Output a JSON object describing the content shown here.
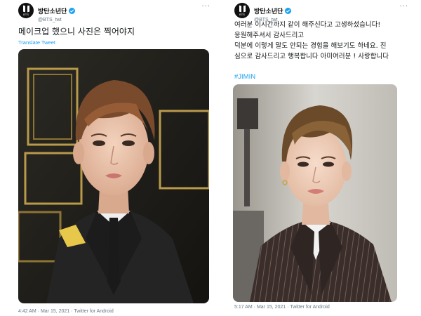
{
  "tweets": [
    {
      "account": {
        "display_name": "방탄소년단",
        "handle": "@BTS_twt",
        "logo_text": "BTS"
      },
      "text": "메이크업 했으니 사진은 찍어야지",
      "translate_label": "Translate Tweet",
      "footer": {
        "time": "4:42 AM",
        "date": "Mar 15, 2021",
        "source": "Twitter for Android",
        "separator": "·"
      }
    },
    {
      "account": {
        "display_name": "방탄소년단",
        "handle": "@BTS_twt",
        "logo_text": "BTS"
      },
      "text_lines": [
        "여러분 이시간까지 같이 해주신다고 고생하셨습니다!",
        "응원해주셔서 감사드리고",
        "덕분에 이렇게 말도 안되는 경험을 해보기도 하네요. 진",
        "심으로 감사드리고 행복합니다 아미여러분 ! 사랑합니다"
      ],
      "hashtag": "#JIMIN",
      "footer": {
        "time": "5:17 AM",
        "date": "Mar 15, 2021",
        "source": "Twitter for Android",
        "separator": "·"
      }
    }
  ],
  "colors": {
    "link": "#1da1f2",
    "muted": "#657786",
    "text": "#14171a"
  },
  "icons": [
    "verified-badge-icon",
    "more-options-icon"
  ]
}
